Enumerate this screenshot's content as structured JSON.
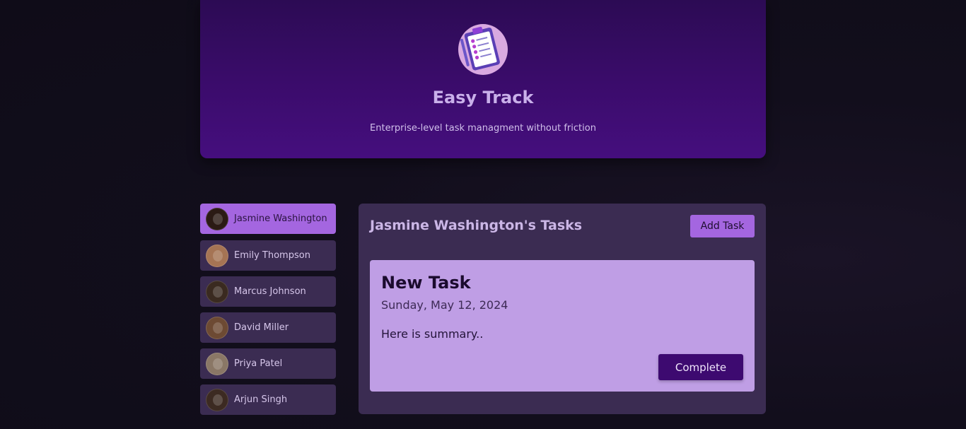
{
  "app": {
    "title": "Easy Track",
    "subtitle": "Enterprise-level task managment without friction",
    "logo_icon": "clipboard-checklist-icon"
  },
  "users": [
    {
      "name": "Jasmine Washington",
      "active": true,
      "avatar_color": "#2b1a14"
    },
    {
      "name": "Emily Thompson",
      "active": false,
      "avatar_color": "#a57454"
    },
    {
      "name": "Marcus Johnson",
      "active": false,
      "avatar_color": "#3a2a20"
    },
    {
      "name": "David Miller",
      "active": false,
      "avatar_color": "#6d4a33"
    },
    {
      "name": "Priya Patel",
      "active": false,
      "avatar_color": "#8a7766"
    },
    {
      "name": "Arjun Singh",
      "active": false,
      "avatar_color": "#3c2a22"
    }
  ],
  "panel": {
    "title": "Jasmine Washington's Tasks",
    "add_label": "Add Task"
  },
  "task": {
    "title": "New Task",
    "date": "Sunday, May 12, 2024",
    "summary": "Here is summary..",
    "complete_label": "Complete"
  },
  "colors": {
    "accent": "#a466e0",
    "header": "#3a0c6a",
    "panel": "#3b2c52",
    "card": "#bf9ee5",
    "button_dark": "#3d0a70"
  }
}
